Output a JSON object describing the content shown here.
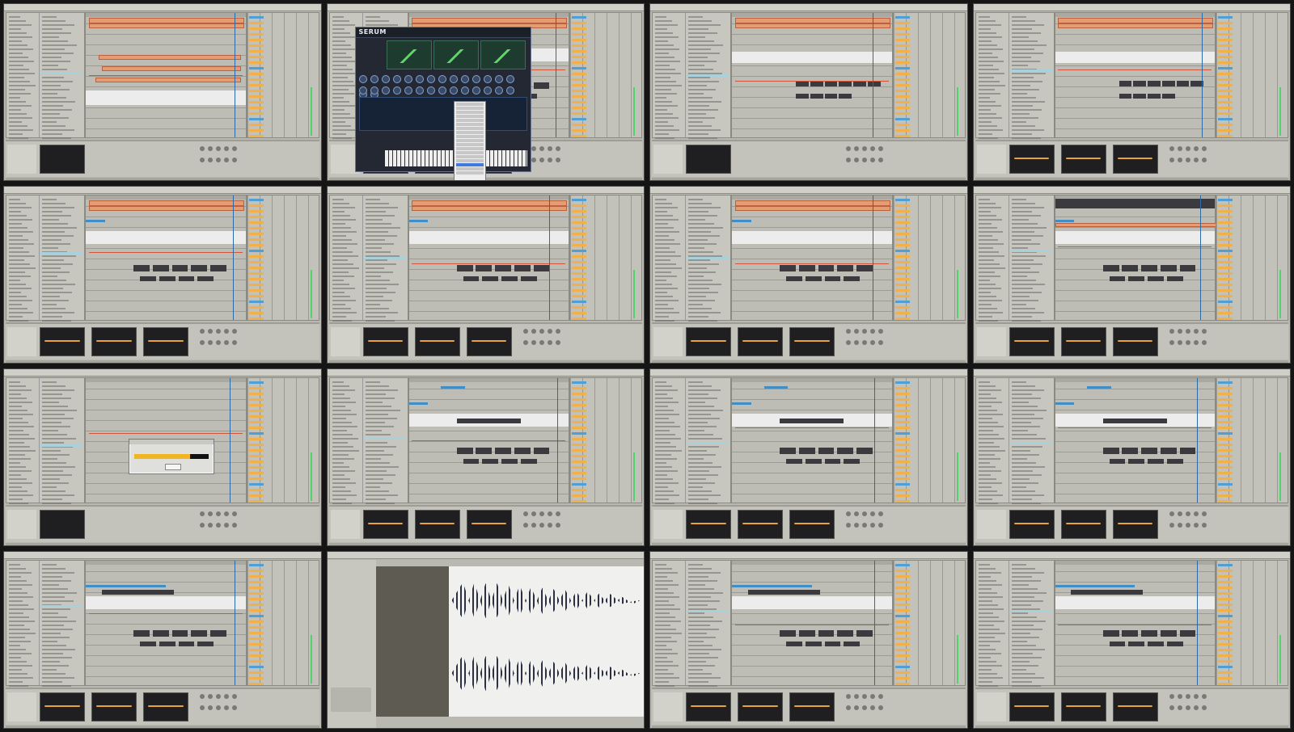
{
  "grid": {
    "rows": 4,
    "cols": 4
  },
  "thumbnails": [
    {
      "id": "t1",
      "kind": "ableton",
      "variant": "orange-midi"
    },
    {
      "id": "t2",
      "kind": "serum",
      "variant": "serum-plugin",
      "serum_title": "SERUM"
    },
    {
      "id": "t3",
      "kind": "ableton",
      "variant": "waves-orange"
    },
    {
      "id": "t4",
      "kind": "ableton",
      "variant": "eq-devices"
    },
    {
      "id": "t5",
      "kind": "ableton",
      "variant": "blue-clips"
    },
    {
      "id": "t6",
      "kind": "ableton",
      "variant": "blue-clips-2"
    },
    {
      "id": "t7",
      "kind": "ableton",
      "variant": "blue-clips-3"
    },
    {
      "id": "t8",
      "kind": "ableton",
      "variant": "dense-top"
    },
    {
      "id": "t9",
      "kind": "ableton",
      "variant": "modal-progress"
    },
    {
      "id": "t10",
      "kind": "ableton",
      "variant": "vocal-clips"
    },
    {
      "id": "t11",
      "kind": "ableton",
      "variant": "vocal-clips-2"
    },
    {
      "id": "t12",
      "kind": "ableton",
      "variant": "vocal-clips-3"
    },
    {
      "id": "t13",
      "kind": "ableton",
      "variant": "edits"
    },
    {
      "id": "t14",
      "kind": "zoomed-wave",
      "variant": "zoomed-waveform"
    },
    {
      "id": "t15",
      "kind": "ableton",
      "variant": "edits-2"
    },
    {
      "id": "t16",
      "kind": "ableton",
      "variant": "edits-3"
    }
  ],
  "colors": {
    "orange": "#e59b74",
    "blue": "#3f8fc6",
    "automation": "#d2553a",
    "mixer_tag": "#f0b14a",
    "meter": "#4ed46a"
  }
}
